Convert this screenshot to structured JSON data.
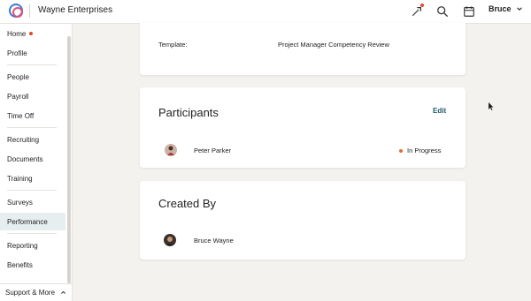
{
  "header": {
    "company_name": "Wayne Enterprises",
    "user_name": "Bruce",
    "icons": [
      "logo-icon",
      "rocket-icon",
      "search-icon",
      "calendar-icon",
      "chevron-down-icon"
    ]
  },
  "sidebar": {
    "items": [
      {
        "label": "Home",
        "has_dot": true
      },
      {
        "label": "Profile"
      },
      {
        "label": "People"
      },
      {
        "label": "Payroll"
      },
      {
        "label": "Time Off"
      },
      {
        "label": "Recruiting"
      },
      {
        "label": "Documents"
      },
      {
        "label": "Training"
      },
      {
        "label": "Surveys"
      },
      {
        "label": "Performance",
        "active": true
      },
      {
        "label": "Reporting"
      },
      {
        "label": "Benefits"
      }
    ],
    "support_label": "Support & More"
  },
  "template_card": {
    "label": "Template:",
    "value": "Project Manager Competency Review"
  },
  "participants_card": {
    "title": "Participants",
    "edit_label": "Edit",
    "participant": {
      "name": "Peter Parker",
      "status": "In Progress"
    }
  },
  "created_by_card": {
    "title": "Created By",
    "creator": {
      "name": "Bruce Wayne"
    }
  },
  "colors": {
    "accent_teal": "#1d5a6b",
    "notification_red": "#e04a2c",
    "status_orange": "#e66b2c",
    "active_nav_bg": "#e7eef0"
  }
}
